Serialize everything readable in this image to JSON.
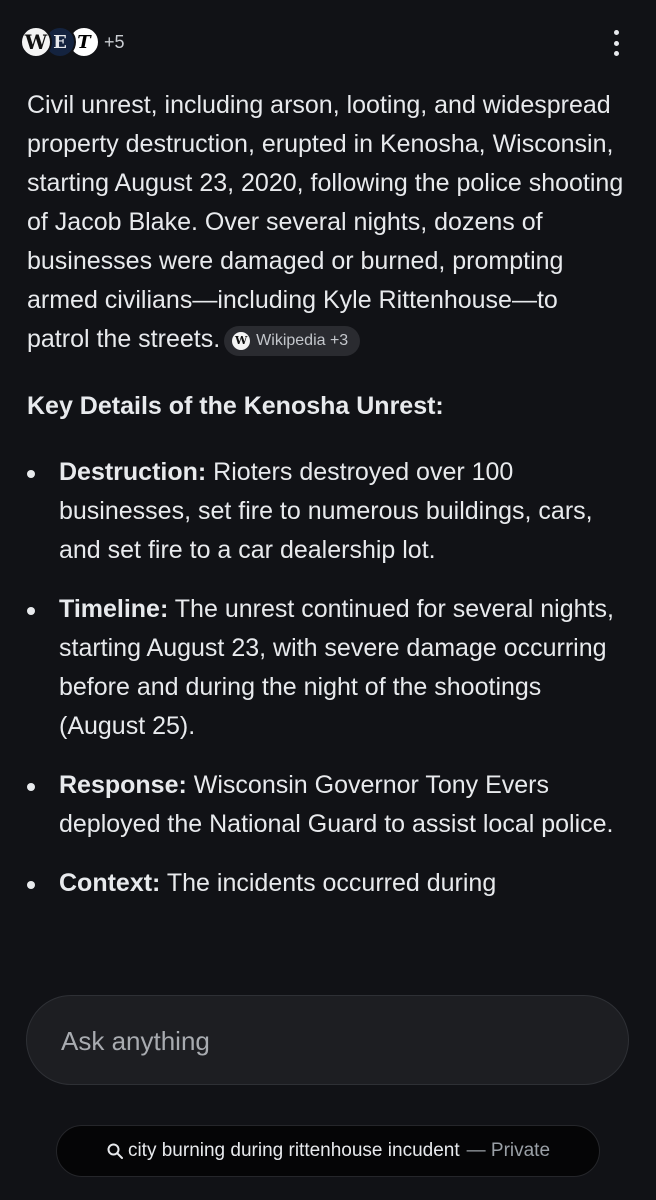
{
  "header": {
    "sources": [
      {
        "icon": "wikipedia-icon",
        "glyph": "W"
      },
      {
        "icon": "publisher-e-icon",
        "glyph": "E"
      },
      {
        "icon": "nytimes-icon",
        "glyph": "T"
      }
    ],
    "more_count": "+5",
    "menu_icon": "more-vert-icon"
  },
  "answer": {
    "summary": "Civil unrest, including arson, looting, and widespread property destruction, erupted in Kenosha, Wisconsin, starting August 23, 2020, following the police shooting of Jacob Blake. Over several nights, dozens of businesses were damaged or burned, prompting armed civilians—including Kyle Rittenhouse—to patrol the streets.",
    "citation": {
      "icon_glyph": "W",
      "label": "Wikipedia +3"
    },
    "section_heading": "Key Details of the Kenosha Unrest:",
    "details": [
      {
        "term": "Destruction:",
        "text": " Rioters destroyed over 100 businesses, set fire to numerous buildings, cars, and set fire to a car dealership lot."
      },
      {
        "term": "Timeline:",
        "text": " The unrest continued for several nights, starting August 23, with severe damage occurring before and during the night of the shootings (August 25)."
      },
      {
        "term": "Response:",
        "text": " Wisconsin Governor Tony Evers deployed the National Guard to assist local police."
      },
      {
        "term": "Context:",
        "text": " The incidents occurred during"
      }
    ]
  },
  "ask": {
    "placeholder": "Ask anything"
  },
  "query_chip": {
    "query": "city burning during rittenhouse incudent",
    "separator": "—",
    "privacy": "Private"
  },
  "colors": {
    "background": "#111216",
    "text": "#e8eaed",
    "muted": "#9aa0a6",
    "chip_background": "#2a2b30",
    "input_background": "#1d1e22"
  }
}
